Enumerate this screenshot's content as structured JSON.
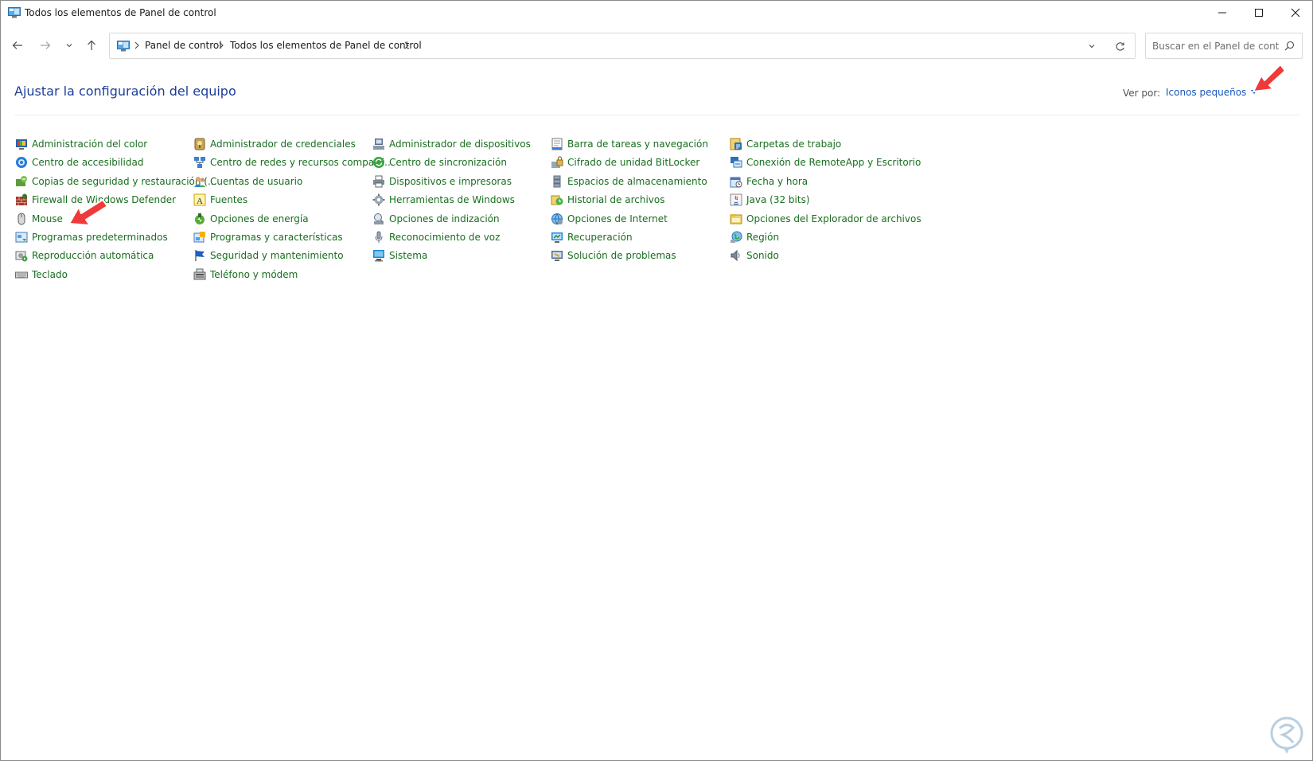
{
  "window": {
    "title": "Todos los elementos de Panel de control"
  },
  "address": {
    "crumbs": [
      "Panel de control",
      "Todos los elementos de Panel de control"
    ]
  },
  "search": {
    "placeholder": "Buscar en el Panel de control"
  },
  "header": {
    "title": "Ajustar la configuración del equipo",
    "view_label": "Ver por:",
    "view_value": "Iconos pequeños"
  },
  "columns": [
    {
      "items": [
        {
          "label": "Administración del color",
          "icon": "color-management-icon"
        },
        {
          "label": "Centro de accesibilidad",
          "icon": "accessibility-icon"
        },
        {
          "label": "Copias de seguridad y restauración (...",
          "icon": "backup-restore-icon"
        },
        {
          "label": "Firewall de Windows Defender",
          "icon": "firewall-icon"
        },
        {
          "label": "Mouse",
          "icon": "mouse-icon"
        },
        {
          "label": "Programas predeterminados",
          "icon": "default-programs-icon"
        },
        {
          "label": "Reproducción automática",
          "icon": "autoplay-icon"
        },
        {
          "label": "Teclado",
          "icon": "keyboard-icon"
        }
      ]
    },
    {
      "items": [
        {
          "label": "Administrador de credenciales",
          "icon": "credential-manager-icon"
        },
        {
          "label": "Centro de redes y recursos comparti...",
          "icon": "network-center-icon"
        },
        {
          "label": "Cuentas de usuario",
          "icon": "user-accounts-icon"
        },
        {
          "label": "Fuentes",
          "icon": "fonts-icon"
        },
        {
          "label": "Opciones de energía",
          "icon": "power-options-icon"
        },
        {
          "label": "Programas y características",
          "icon": "programs-features-icon"
        },
        {
          "label": "Seguridad y mantenimiento",
          "icon": "security-flag-icon"
        },
        {
          "label": "Teléfono y módem",
          "icon": "phone-modem-icon"
        }
      ]
    },
    {
      "items": [
        {
          "label": "Administrador de dispositivos",
          "icon": "device-manager-icon"
        },
        {
          "label": "Centro de sincronización",
          "icon": "sync-center-icon"
        },
        {
          "label": "Dispositivos e impresoras",
          "icon": "printer-icon"
        },
        {
          "label": "Herramientas de Windows",
          "icon": "windows-tools-icon"
        },
        {
          "label": "Opciones de indización",
          "icon": "indexing-icon"
        },
        {
          "label": "Reconocimiento de voz",
          "icon": "microphone-icon"
        },
        {
          "label": "Sistema",
          "icon": "system-icon"
        }
      ]
    },
    {
      "items": [
        {
          "label": "Barra de tareas y navegación",
          "icon": "taskbar-icon"
        },
        {
          "label": "Cifrado de unidad BitLocker",
          "icon": "bitlocker-icon"
        },
        {
          "label": "Espacios de almacenamiento",
          "icon": "storage-spaces-icon"
        },
        {
          "label": "Historial de archivos",
          "icon": "file-history-icon"
        },
        {
          "label": "Opciones de Internet",
          "icon": "internet-options-icon"
        },
        {
          "label": "Recuperación",
          "icon": "recovery-icon"
        },
        {
          "label": "Solución de problemas",
          "icon": "troubleshooting-icon"
        }
      ]
    },
    {
      "items": [
        {
          "label": "Carpetas de trabajo",
          "icon": "work-folders-icon"
        },
        {
          "label": "Conexión de RemoteApp y Escritorio",
          "icon": "remoteapp-icon"
        },
        {
          "label": "Fecha y hora",
          "icon": "date-time-icon"
        },
        {
          "label": "Java (32 bits)",
          "icon": "java-icon"
        },
        {
          "label": "Opciones del Explorador de archivos",
          "icon": "explorer-options-icon"
        },
        {
          "label": "Región",
          "icon": "region-icon"
        },
        {
          "label": "Sonido",
          "icon": "sound-icon"
        }
      ]
    }
  ],
  "colors": {
    "item_text": "#186e1e",
    "heading": "#1a3e9a",
    "link": "#1a56b8",
    "arrow": "#f0393a"
  }
}
